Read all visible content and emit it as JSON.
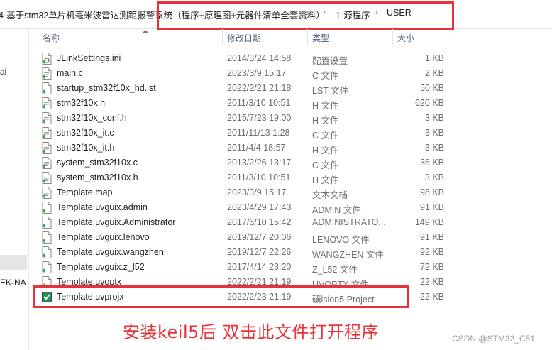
{
  "breadcrumb": {
    "path": "4-基于stm32单片机毫米波雷达测距报警系统（程序+原理图+元器件清单全套资料）",
    "sep1": "›",
    "folder1": "1-源程序",
    "sep2": "›",
    "folder2": "USER"
  },
  "sidebar": {
    "frag1": "al",
    "frag2": "EK-NA"
  },
  "columns": {
    "name": "名称",
    "date": "修改日期",
    "type": "类型",
    "size": "大小"
  },
  "files": [
    {
      "name": "JLinkSettings.ini",
      "date": "2014/3/24 14:58",
      "type": "配置设置",
      "size": "1 KB",
      "icon": "settings-file-icon"
    },
    {
      "name": "main.c",
      "date": "2023/3/9 15:17",
      "type": "C 文件",
      "size": "2 KB",
      "icon": "c-file-icon"
    },
    {
      "name": "startup_stm32f10x_hd.lst",
      "date": "2022/2/21 21:18",
      "type": "LST 文件",
      "size": "50 KB",
      "icon": "file-icon"
    },
    {
      "name": "stm32f10x.h",
      "date": "2011/3/10 10:51",
      "type": "H 文件",
      "size": "620 KB",
      "icon": "h-file-icon"
    },
    {
      "name": "stm32f10x_conf.h",
      "date": "2015/7/23 19:00",
      "type": "H 文件",
      "size": "3 KB",
      "icon": "h-file-icon"
    },
    {
      "name": "stm32f10x_it.c",
      "date": "2011/11/13 1:28",
      "type": "C 文件",
      "size": "3 KB",
      "icon": "c-file-icon"
    },
    {
      "name": "stm32f10x_it.h",
      "date": "2011/4/4 18:57",
      "type": "H 文件",
      "size": "3 KB",
      "icon": "h-file-icon"
    },
    {
      "name": "system_stm32f10x.c",
      "date": "2013/2/26 13:17",
      "type": "C 文件",
      "size": "36 KB",
      "icon": "c-file-icon"
    },
    {
      "name": "system_stm32f10x.h",
      "date": "2011/3/10 10:51",
      "type": "H 文件",
      "size": "3 KB",
      "icon": "h-file-icon"
    },
    {
      "name": "Template.map",
      "date": "2023/3/9 15:17",
      "type": "文本文档",
      "size": "98 KB",
      "icon": "text-file-icon"
    },
    {
      "name": "Template.uvguix.admin",
      "date": "2023/4/29 17:43",
      "type": "ADMIN 文件",
      "size": "91 KB",
      "icon": "file-icon"
    },
    {
      "name": "Template.uvguix.Administrator",
      "date": "2017/6/10 15:42",
      "type": "ADMINISTRATO...",
      "size": "149 KB",
      "icon": "file-icon"
    },
    {
      "name": "Template.uvguix.lenovo",
      "date": "2019/12/7 20:06",
      "type": "LENOVO 文件",
      "size": "91 KB",
      "icon": "file-icon"
    },
    {
      "name": "Template.uvguix.wangzhen",
      "date": "2019/12/7 22:26",
      "type": "WANGZHEN 文件",
      "size": "92 KB",
      "icon": "file-icon"
    },
    {
      "name": "Template.uvguix.z_l52",
      "date": "2017/4/14 23:20",
      "type": "Z_L52 文件",
      "size": "72 KB",
      "icon": "file-icon"
    },
    {
      "name": "Template.uvoptx",
      "date": "2022/2/21 21:19",
      "type": "UVOPTX 文件",
      "size": "22 KB",
      "icon": "file-icon"
    },
    {
      "name": "Template.uvprojx",
      "date": "2022/2/23 21:19",
      "type": "礦ision5 Project",
      "size": "22 KB",
      "icon": "keil-project-icon"
    }
  ],
  "caption": "安装keil5后  双击此文件打开程序",
  "watermark": "CSDN @STM32_C51",
  "colors": {
    "annotation": "#e8323a",
    "header_text": "#4c607a"
  }
}
